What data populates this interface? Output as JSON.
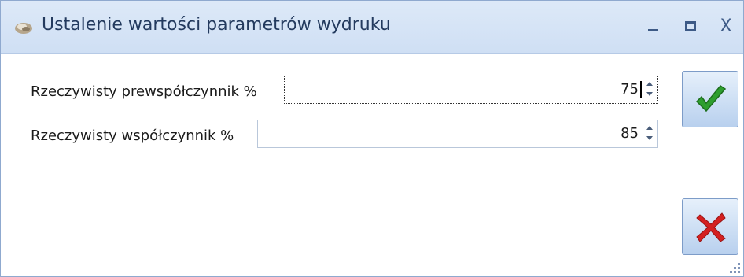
{
  "window": {
    "title": "Ustalenie wartości parametrów wydruku",
    "controls": {
      "minimize": "–",
      "maximize": "□",
      "close": "X"
    }
  },
  "form": {
    "fields": [
      {
        "label": "Rzeczywisty prewspółczynnik %",
        "value": "75",
        "focused": true
      },
      {
        "label": "Rzeczywisty współczynnik %",
        "value": "85",
        "focused": false
      }
    ]
  },
  "buttons": {
    "ok_icon": "green-checkmark-icon",
    "cancel_icon": "red-x-icon"
  },
  "colors": {
    "titlebar": "#d6e4f6",
    "title_text": "#233a5e",
    "check": "#2e9e2e",
    "cross": "#d42020"
  }
}
